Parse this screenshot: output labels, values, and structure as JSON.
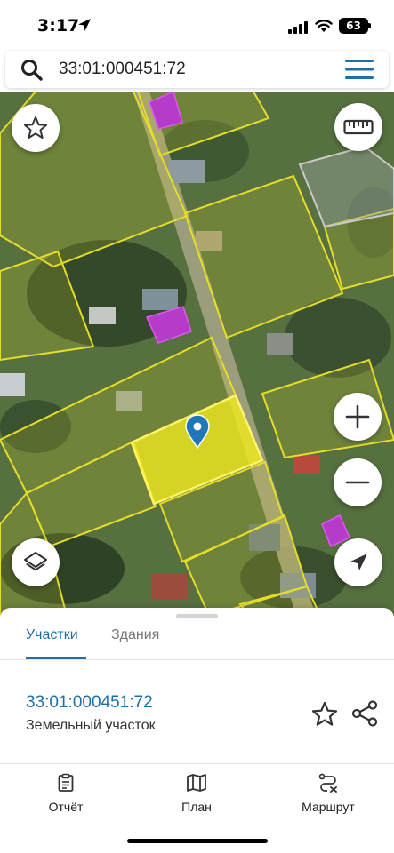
{
  "status_bar": {
    "time": "3:17",
    "battery": "63"
  },
  "search": {
    "value": "33:01:000451:72"
  },
  "map": {
    "selected_parcel_color": "#f2ea1f",
    "parcel_outline_color": "#e6dc2a",
    "building_color": "#b43cc8"
  },
  "map_controls": {
    "favorite": "star-icon",
    "measure": "ruler-icon",
    "zoom_in": "plus-icon",
    "zoom_out": "minus-icon",
    "layers": "layers-icon",
    "locate": "location-arrow-icon"
  },
  "tabs": [
    {
      "label": "Участки",
      "active": true
    },
    {
      "label": "Здания",
      "active": false
    }
  ],
  "parcel": {
    "number": "33:01:000451:72",
    "type": "Земельный участок"
  },
  "bottom_nav": [
    {
      "label": "Отчёт",
      "icon": "report-icon"
    },
    {
      "label": "План",
      "icon": "map-icon"
    },
    {
      "label": "Маршрут",
      "icon": "route-icon"
    }
  ],
  "colors": {
    "accent": "#1f6fa6"
  }
}
